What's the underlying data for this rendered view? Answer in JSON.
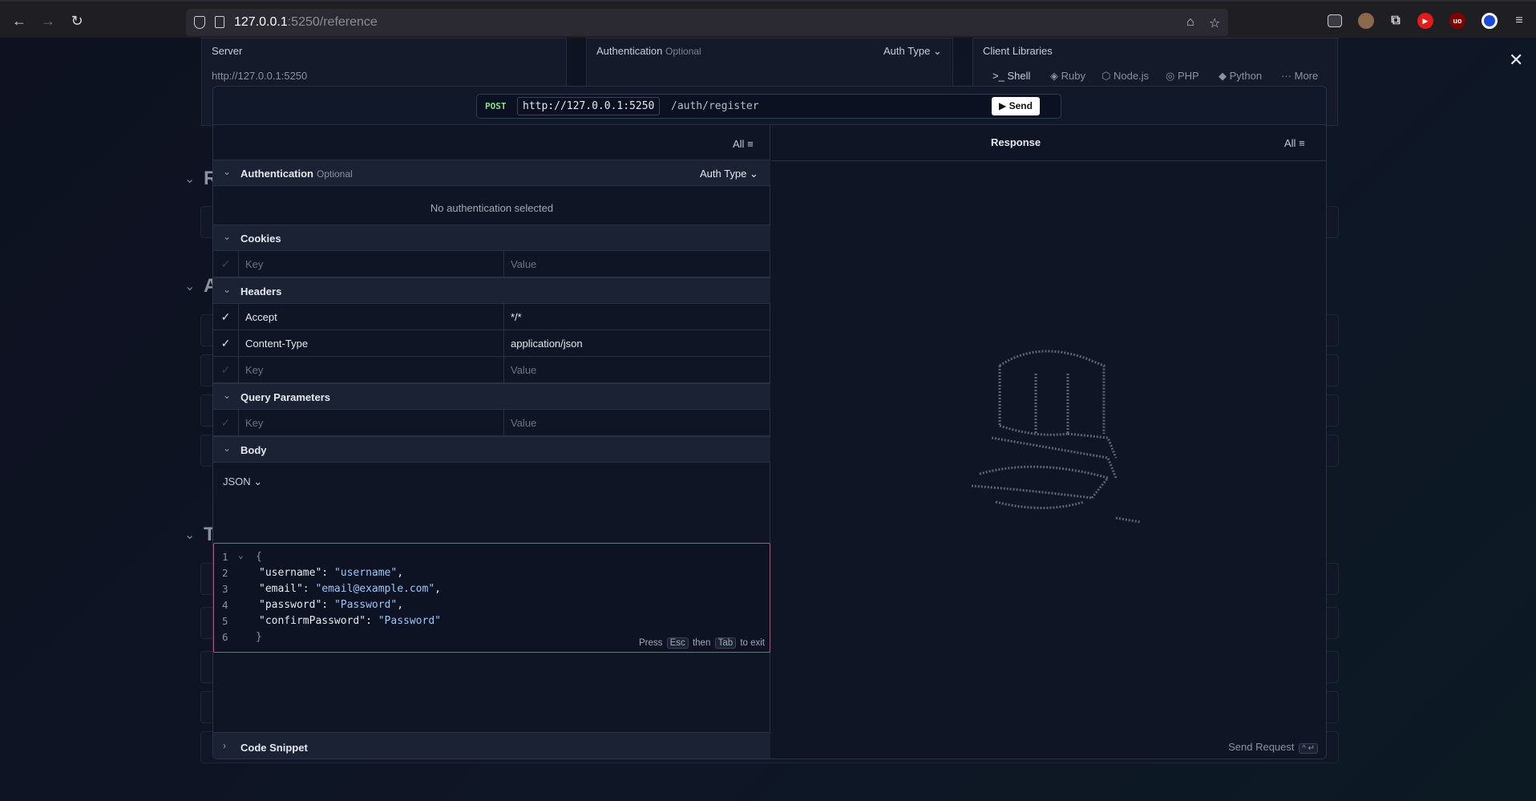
{
  "browser": {
    "url_host": "127.0.0.1",
    "url_rest": ":5250/reference"
  },
  "background": {
    "server": {
      "title": "Server",
      "value": "http://127.0.0.1:5250"
    },
    "auth": {
      "title": "Authentication",
      "optional": "Optional",
      "auth_type": "Auth Type"
    },
    "clients": {
      "title": "Client Libraries",
      "tabs": [
        "Shell",
        "Ruby",
        "Node.js",
        "PHP",
        "Python",
        "More"
      ]
    },
    "section_letters": [
      "R",
      "A",
      "T"
    ]
  },
  "request": {
    "method": "POST",
    "base_url": "http://127.0.0.1:5250",
    "path": "/auth/register",
    "send_label": "Send",
    "filter_label": "All",
    "auth": {
      "title": "Authentication",
      "optional": "Optional",
      "auth_type": "Auth Type",
      "empty": "No authentication selected"
    },
    "cookies": {
      "title": "Cookies",
      "key_placeholder": "Key",
      "value_placeholder": "Value"
    },
    "headers": {
      "title": "Headers",
      "rows": [
        {
          "key": "Accept",
          "value": "*/*"
        },
        {
          "key": "Content-Type",
          "value": "application/json"
        }
      ],
      "key_placeholder": "Key",
      "value_placeholder": "Value"
    },
    "query": {
      "title": "Query Parameters",
      "key_placeholder": "Key",
      "value_placeholder": "Value"
    },
    "body": {
      "title": "Body",
      "content_type": "JSON",
      "line_numbers": [
        "1",
        "2",
        "3",
        "4",
        "5",
        "6"
      ],
      "lines": {
        "open": "{",
        "l2_key": "\"username\"",
        "l2_val": "\"username\"",
        "l3_key": "\"email\"",
        "l3_val": "\"email@example.com\"",
        "l4_key": "\"password\"",
        "l4_val": "\"Password\"",
        "l5_key": "\"confirmPassword\"",
        "l5_val": "\"Password\"",
        "close": "}"
      },
      "hint_press": "Press",
      "hint_esc": "Esc",
      "hint_then": "then",
      "hint_tab": "Tab",
      "hint_exit": "to exit"
    },
    "code_snippet": "Code Snippet"
  },
  "response": {
    "title": "Response",
    "filter_label": "All",
    "send_request": "Send Request",
    "shortcut": "^ ↵"
  }
}
